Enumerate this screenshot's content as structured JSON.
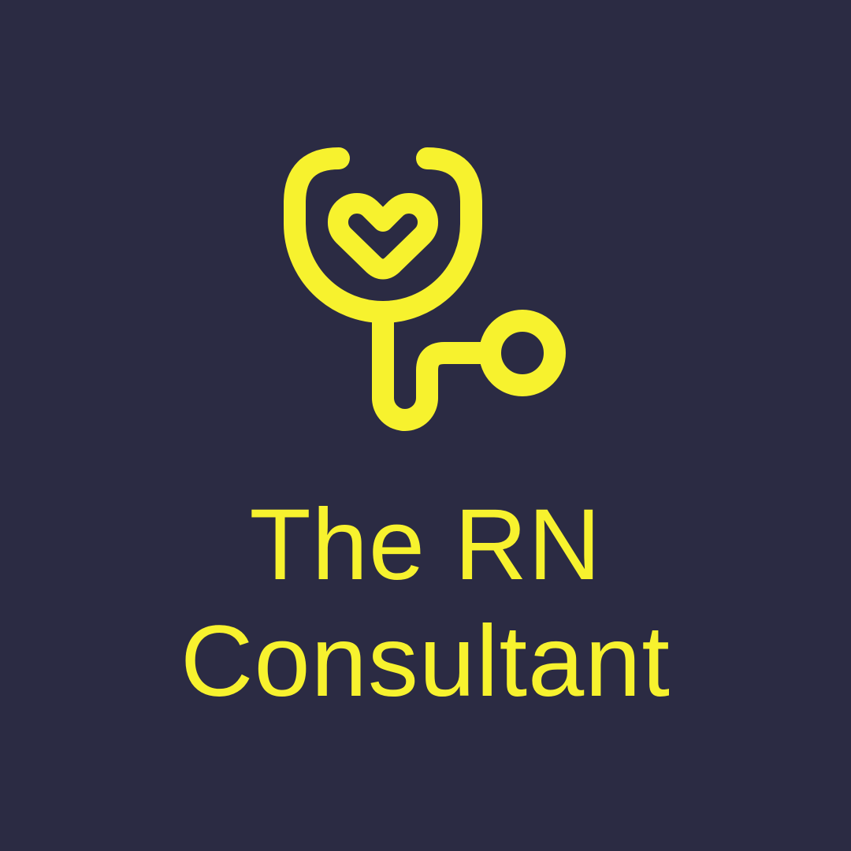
{
  "brand": {
    "name_line1": "The RN",
    "name_line2": "Consultant",
    "icon": "stethoscope-heart-icon",
    "colors": {
      "background": "#2b2b43",
      "accent": "#f7f22e"
    }
  }
}
